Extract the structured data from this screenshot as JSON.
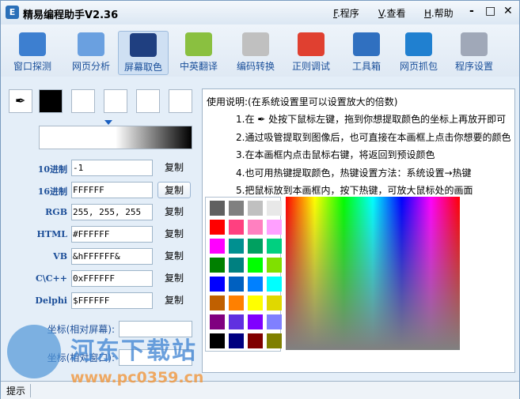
{
  "title": "精易编程助手V2.36",
  "menu": [
    {
      "key": "F",
      "label": ".程序"
    },
    {
      "key": "V",
      "label": ".查看"
    },
    {
      "key": "H",
      "label": ".帮助"
    }
  ],
  "window_buttons": {
    "minimize": "-",
    "maximize": "□",
    "close": "✕"
  },
  "toolbar": [
    "窗口探测",
    "网页分析",
    "屏幕取色",
    "中英翻译",
    "编码转换",
    "正则调试",
    "工具箱",
    "网页抓包",
    "程序设置"
  ],
  "active_tool": "屏幕取色",
  "fields": [
    {
      "label": "10进制",
      "value": "-1",
      "copy": "复制"
    },
    {
      "label": "16进制",
      "value": "FFFFFF",
      "copy": "复制"
    },
    {
      "label": "RGB",
      "value": "255, 255, 255",
      "copy": "复制"
    },
    {
      "label": "HTML",
      "value": "#FFFFFF",
      "copy": "复制"
    },
    {
      "label": "VB",
      "value": "&hFFFFFF&",
      "copy": "复制"
    },
    {
      "label": "C\\C++",
      "value": "0xFFFFFF",
      "copy": "复制"
    },
    {
      "label": "Delphi",
      "value": "$FFFFFF",
      "copy": "复制"
    }
  ],
  "coords": {
    "screen_label": "坐标(相对屏幕):",
    "window_label": "坐标(相对窗口):"
  },
  "help": {
    "title": "使用说明:(在系统设置里可以设置放大的倍数)",
    "line1a": "1.在",
    "line1b": "处按下鼠标左键，拖到你想提取颜色的坐标上再放开即可",
    "line2": "2.通过吸管提取到图像后，也可直接在本画框上点击你想要的颜色",
    "line3": "3.在本画框内点击鼠标右键，将返回到预设颜色",
    "line4": "4.也可用热键提取颜色，热键设置方法：系统设置→热键",
    "line5": "5.把鼠标放到本画框内，按下热键，可放大鼠标处的画面"
  },
  "palette": [
    "#606060",
    "#808080",
    "#c0c0c0",
    "#e8e8e8",
    "#ff0000",
    "#ff4080",
    "#ff80c0",
    "#ffa0ff",
    "#ff00ff",
    "#009090",
    "#00a060",
    "#00d080",
    "#008000",
    "#008080",
    "#00ff00",
    "#80e000",
    "#0000ff",
    "#0060c0",
    "#0080ff",
    "#00ffff",
    "#c06000",
    "#ff8000",
    "#ffff00",
    "#e0d800",
    "#800080",
    "#6030e0",
    "#8000ff",
    "#8080ff",
    "#000000",
    "#000080",
    "#800000",
    "#808000"
  ],
  "status": "提示",
  "watermark": {
    "name": "河东下载站",
    "url": "www.pc0359.cn"
  }
}
